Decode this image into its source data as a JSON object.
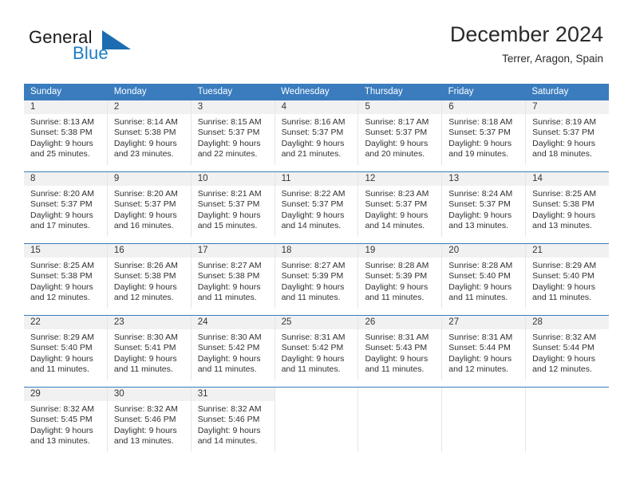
{
  "brand": {
    "name_part1": "General",
    "name_part2": "Blue",
    "logo_colors": {
      "text_dark": "#1a1a1a",
      "accent_blue": "#1c7cc4",
      "triangle_blue": "#1b6cb0"
    }
  },
  "header": {
    "title": "December 2024",
    "subtitle": "Terrer, Aragon, Spain"
  },
  "theme": {
    "header_row_bg": "#3a7cbe",
    "header_row_text": "#ffffff",
    "daynum_band_bg": "#f1f1f1",
    "cell_divider": "#e6e6e6",
    "body_text": "#303030"
  },
  "calendar": {
    "weekdays": [
      "Sunday",
      "Monday",
      "Tuesday",
      "Wednesday",
      "Thursday",
      "Friday",
      "Saturday"
    ],
    "weeks": [
      [
        {
          "day": "1",
          "sunrise": "Sunrise: 8:13 AM",
          "sunset": "Sunset: 5:38 PM",
          "daylight_1": "Daylight: 9 hours",
          "daylight_2": "and 25 minutes."
        },
        {
          "day": "2",
          "sunrise": "Sunrise: 8:14 AM",
          "sunset": "Sunset: 5:38 PM",
          "daylight_1": "Daylight: 9 hours",
          "daylight_2": "and 23 minutes."
        },
        {
          "day": "3",
          "sunrise": "Sunrise: 8:15 AM",
          "sunset": "Sunset: 5:37 PM",
          "daylight_1": "Daylight: 9 hours",
          "daylight_2": "and 22 minutes."
        },
        {
          "day": "4",
          "sunrise": "Sunrise: 8:16 AM",
          "sunset": "Sunset: 5:37 PM",
          "daylight_1": "Daylight: 9 hours",
          "daylight_2": "and 21 minutes."
        },
        {
          "day": "5",
          "sunrise": "Sunrise: 8:17 AM",
          "sunset": "Sunset: 5:37 PM",
          "daylight_1": "Daylight: 9 hours",
          "daylight_2": "and 20 minutes."
        },
        {
          "day": "6",
          "sunrise": "Sunrise: 8:18 AM",
          "sunset": "Sunset: 5:37 PM",
          "daylight_1": "Daylight: 9 hours",
          "daylight_2": "and 19 minutes."
        },
        {
          "day": "7",
          "sunrise": "Sunrise: 8:19 AM",
          "sunset": "Sunset: 5:37 PM",
          "daylight_1": "Daylight: 9 hours",
          "daylight_2": "and 18 minutes."
        }
      ],
      [
        {
          "day": "8",
          "sunrise": "Sunrise: 8:20 AM",
          "sunset": "Sunset: 5:37 PM",
          "daylight_1": "Daylight: 9 hours",
          "daylight_2": "and 17 minutes."
        },
        {
          "day": "9",
          "sunrise": "Sunrise: 8:20 AM",
          "sunset": "Sunset: 5:37 PM",
          "daylight_1": "Daylight: 9 hours",
          "daylight_2": "and 16 minutes."
        },
        {
          "day": "10",
          "sunrise": "Sunrise: 8:21 AM",
          "sunset": "Sunset: 5:37 PM",
          "daylight_1": "Daylight: 9 hours",
          "daylight_2": "and 15 minutes."
        },
        {
          "day": "11",
          "sunrise": "Sunrise: 8:22 AM",
          "sunset": "Sunset: 5:37 PM",
          "daylight_1": "Daylight: 9 hours",
          "daylight_2": "and 14 minutes."
        },
        {
          "day": "12",
          "sunrise": "Sunrise: 8:23 AM",
          "sunset": "Sunset: 5:37 PM",
          "daylight_1": "Daylight: 9 hours",
          "daylight_2": "and 14 minutes."
        },
        {
          "day": "13",
          "sunrise": "Sunrise: 8:24 AM",
          "sunset": "Sunset: 5:37 PM",
          "daylight_1": "Daylight: 9 hours",
          "daylight_2": "and 13 minutes."
        },
        {
          "day": "14",
          "sunrise": "Sunrise: 8:25 AM",
          "sunset": "Sunset: 5:38 PM",
          "daylight_1": "Daylight: 9 hours",
          "daylight_2": "and 13 minutes."
        }
      ],
      [
        {
          "day": "15",
          "sunrise": "Sunrise: 8:25 AM",
          "sunset": "Sunset: 5:38 PM",
          "daylight_1": "Daylight: 9 hours",
          "daylight_2": "and 12 minutes."
        },
        {
          "day": "16",
          "sunrise": "Sunrise: 8:26 AM",
          "sunset": "Sunset: 5:38 PM",
          "daylight_1": "Daylight: 9 hours",
          "daylight_2": "and 12 minutes."
        },
        {
          "day": "17",
          "sunrise": "Sunrise: 8:27 AM",
          "sunset": "Sunset: 5:38 PM",
          "daylight_1": "Daylight: 9 hours",
          "daylight_2": "and 11 minutes."
        },
        {
          "day": "18",
          "sunrise": "Sunrise: 8:27 AM",
          "sunset": "Sunset: 5:39 PM",
          "daylight_1": "Daylight: 9 hours",
          "daylight_2": "and 11 minutes."
        },
        {
          "day": "19",
          "sunrise": "Sunrise: 8:28 AM",
          "sunset": "Sunset: 5:39 PM",
          "daylight_1": "Daylight: 9 hours",
          "daylight_2": "and 11 minutes."
        },
        {
          "day": "20",
          "sunrise": "Sunrise: 8:28 AM",
          "sunset": "Sunset: 5:40 PM",
          "daylight_1": "Daylight: 9 hours",
          "daylight_2": "and 11 minutes."
        },
        {
          "day": "21",
          "sunrise": "Sunrise: 8:29 AM",
          "sunset": "Sunset: 5:40 PM",
          "daylight_1": "Daylight: 9 hours",
          "daylight_2": "and 11 minutes."
        }
      ],
      [
        {
          "day": "22",
          "sunrise": "Sunrise: 8:29 AM",
          "sunset": "Sunset: 5:40 PM",
          "daylight_1": "Daylight: 9 hours",
          "daylight_2": "and 11 minutes."
        },
        {
          "day": "23",
          "sunrise": "Sunrise: 8:30 AM",
          "sunset": "Sunset: 5:41 PM",
          "daylight_1": "Daylight: 9 hours",
          "daylight_2": "and 11 minutes."
        },
        {
          "day": "24",
          "sunrise": "Sunrise: 8:30 AM",
          "sunset": "Sunset: 5:42 PM",
          "daylight_1": "Daylight: 9 hours",
          "daylight_2": "and 11 minutes."
        },
        {
          "day": "25",
          "sunrise": "Sunrise: 8:31 AM",
          "sunset": "Sunset: 5:42 PM",
          "daylight_1": "Daylight: 9 hours",
          "daylight_2": "and 11 minutes."
        },
        {
          "day": "26",
          "sunrise": "Sunrise: 8:31 AM",
          "sunset": "Sunset: 5:43 PM",
          "daylight_1": "Daylight: 9 hours",
          "daylight_2": "and 11 minutes."
        },
        {
          "day": "27",
          "sunrise": "Sunrise: 8:31 AM",
          "sunset": "Sunset: 5:44 PM",
          "daylight_1": "Daylight: 9 hours",
          "daylight_2": "and 12 minutes."
        },
        {
          "day": "28",
          "sunrise": "Sunrise: 8:32 AM",
          "sunset": "Sunset: 5:44 PM",
          "daylight_1": "Daylight: 9 hours",
          "daylight_2": "and 12 minutes."
        }
      ],
      [
        {
          "day": "29",
          "sunrise": "Sunrise: 8:32 AM",
          "sunset": "Sunset: 5:45 PM",
          "daylight_1": "Daylight: 9 hours",
          "daylight_2": "and 13 minutes."
        },
        {
          "day": "30",
          "sunrise": "Sunrise: 8:32 AM",
          "sunset": "Sunset: 5:46 PM",
          "daylight_1": "Daylight: 9 hours",
          "daylight_2": "and 13 minutes."
        },
        {
          "day": "31",
          "sunrise": "Sunrise: 8:32 AM",
          "sunset": "Sunset: 5:46 PM",
          "daylight_1": "Daylight: 9 hours",
          "daylight_2": "and 14 minutes."
        },
        {
          "day": "",
          "sunrise": "",
          "sunset": "",
          "daylight_1": "",
          "daylight_2": ""
        },
        {
          "day": "",
          "sunrise": "",
          "sunset": "",
          "daylight_1": "",
          "daylight_2": ""
        },
        {
          "day": "",
          "sunrise": "",
          "sunset": "",
          "daylight_1": "",
          "daylight_2": ""
        },
        {
          "day": "",
          "sunrise": "",
          "sunset": "",
          "daylight_1": "",
          "daylight_2": ""
        }
      ]
    ]
  }
}
